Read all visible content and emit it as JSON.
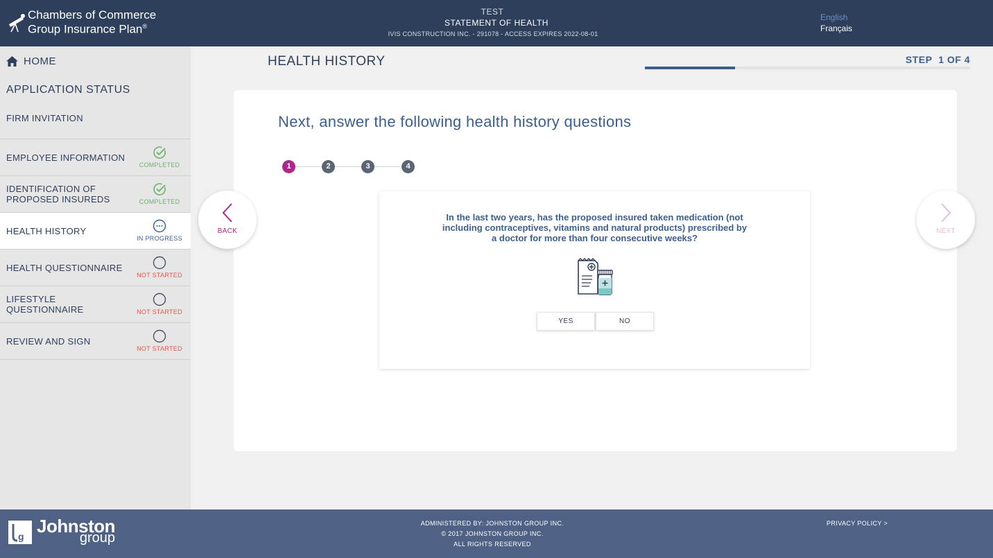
{
  "header": {
    "brand_line1": "Chambers of Commerce",
    "brand_line2": "Group Insurance Plan",
    "brand_mark": "®",
    "env": "TEST",
    "title": "STATEMENT OF HEALTH",
    "subtitle": "IVIS CONSTRUCTION INC. - 291078 - ACCESS EXPIRES 2022-08-01",
    "languages": {
      "english": "English",
      "french": "Français"
    },
    "colors": {
      "background": "#2e3f5c",
      "active_language": "#6f8fbf"
    }
  },
  "sidebar": {
    "home": "HOME",
    "title": "APPLICATION STATUS",
    "firm": "FIRM INVITATION",
    "items": [
      {
        "label": "EMPLOYEE INFORMATION",
        "status": "COMPLETED",
        "icon": "check-circle-icon"
      },
      {
        "label": "IDENTIFICATION OF PROPOSED INSUREDS",
        "status": "COMPLETED",
        "icon": "check-circle-icon"
      },
      {
        "label": "HEALTH HISTORY",
        "status": "IN PROGRESS",
        "icon": "ellipsis-circle-icon"
      },
      {
        "label": "HEALTH QUESTIONNAIRE",
        "status": "NOT STARTED",
        "icon": "empty-circle-icon"
      },
      {
        "label": "LIFESTYLE QUESTIONNAIRE",
        "status": "NOT STARTED",
        "icon": "empty-circle-icon"
      },
      {
        "label": "REVIEW AND SIGN",
        "status": "NOT STARTED",
        "icon": "empty-circle-icon"
      }
    ],
    "colors": {
      "completed": "#6ab36a",
      "in_progress": "#3c5f91",
      "not_started": "#e0584f"
    }
  },
  "main": {
    "title": "HEALTH HISTORY",
    "step_label": "STEP",
    "step_value": "1 OF 4",
    "progress": 0.277,
    "card_title": "Next, answer the following health history questions",
    "sub_steps": [
      "1",
      "2",
      "3",
      "4"
    ],
    "active_sub_step": 1,
    "back": "BACK",
    "next": "NEXT",
    "question": "In the last two years, has the proposed insured taken medication (not including contraceptives, vitamins and natural products) prescribed by a doctor for more than four consecutive weeks?",
    "question_icon": "prescription-medication-icon",
    "answers": {
      "yes": "YES",
      "no": "NO"
    },
    "colors": {
      "accent": "#b0268a",
      "primary": "#3c5f91"
    }
  },
  "footer": {
    "logo_line1": "Johnston",
    "logo_line2": "group",
    "administered": "ADMINISTERED BY: JOHNSTON GROUP INC.",
    "copyright": "© 2017 JOHNSTON GROUP INC.",
    "rights": "ALL RIGHTS RESERVED",
    "privacy": "PRIVACY POLICY >",
    "colors": {
      "background": "#4f6285"
    }
  }
}
